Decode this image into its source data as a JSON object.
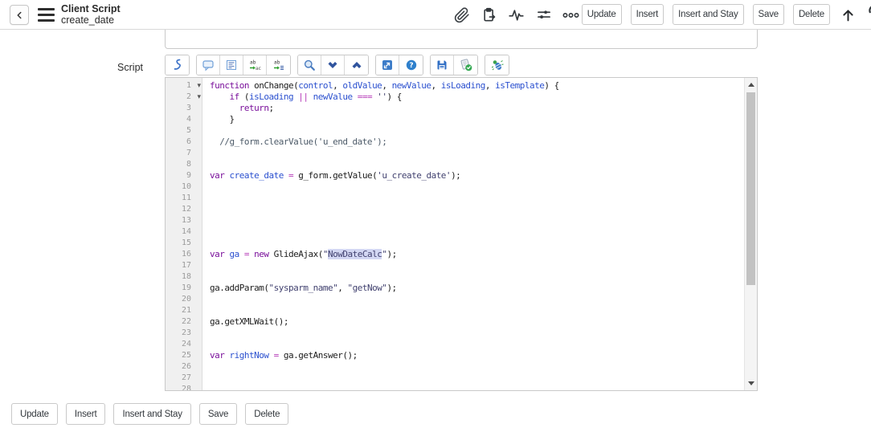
{
  "header": {
    "title": "Client Script",
    "subtitle": "create_date",
    "back_label": "back",
    "icons": [
      "attachment",
      "paste",
      "activity-stream",
      "personalize",
      "more-options"
    ],
    "actions": [
      "Update",
      "Insert",
      "Insert and Stay",
      "Save",
      "Delete"
    ]
  },
  "form": {
    "field_value": "",
    "script_label": "Script"
  },
  "toolbar": {
    "icon_groups": [
      [
        "script-format"
      ],
      [
        "comment",
        "format-lines",
        "replace",
        "replace-all"
      ],
      [
        "search",
        "collapse-all",
        "expand-all"
      ],
      [
        "open-window",
        "help"
      ],
      [
        "save-script",
        "syntax-check"
      ],
      [
        "debug"
      ]
    ]
  },
  "editor": {
    "total_lines": 28,
    "folded_lines": [
      1,
      2
    ],
    "selection_highlight": "NowDateCalc",
    "colors": {
      "keyword": "#7a109b",
      "variable": "#2b50cf",
      "operator": "#b53ab8",
      "string": "#41416f",
      "comment": "#4c5a68",
      "selection_bg": "#d3d7f3",
      "gutter_bg": "#f0f0f0",
      "line_number": "#9b9b9b"
    },
    "code_lines": [
      "function onChange(control, oldValue, newValue, isLoading, isTemplate) {",
      "    if (isLoading || newValue === '') {",
      "      return;",
      "    }",
      "",
      "  //g_form.clearValue('u_end_date');",
      "",
      "",
      "var create_date = g_form.getValue('u_create_date');",
      "",
      "",
      "",
      "",
      "",
      "",
      "var ga = new GlideAjax(\"NowDateCalc\");",
      "",
      "",
      "ga.addParam(\"sysparm_name\", \"getNow\");",
      "",
      "",
      "ga.getXMLWait();",
      "",
      "",
      "var rightNow = ga.getAnswer();",
      "",
      "",
      ""
    ]
  },
  "footer": {
    "actions": [
      "Update",
      "Insert",
      "Insert and Stay",
      "Save",
      "Delete"
    ]
  }
}
